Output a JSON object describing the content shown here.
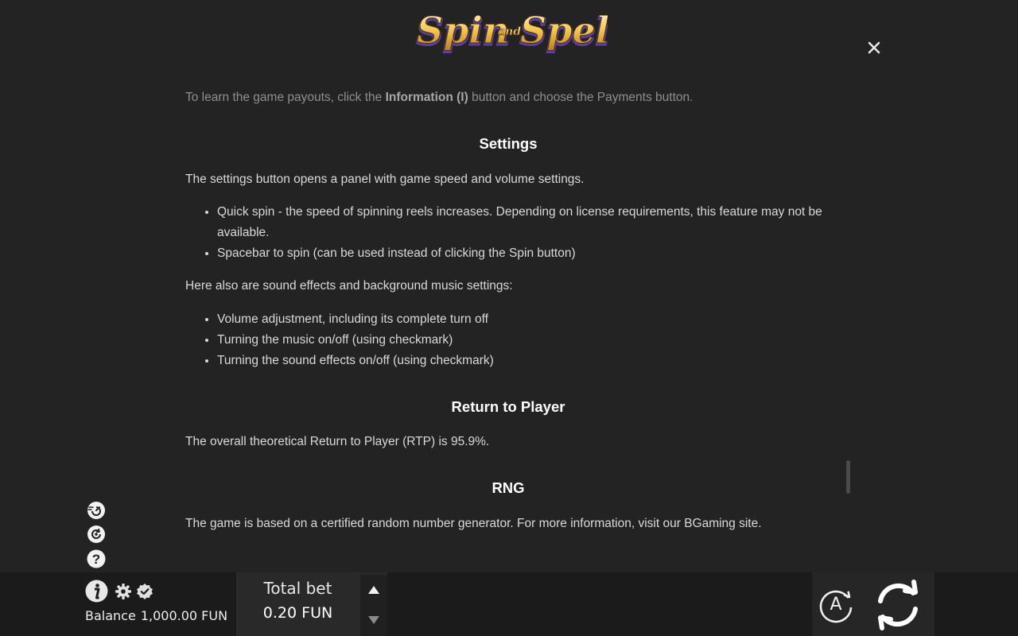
{
  "logo": {
    "word1": "Spin",
    "word2": "and",
    "word3": "Spell"
  },
  "close_icon": "close-icon",
  "rules": {
    "payouts_note": {
      "before": "To learn the game payouts, click the ",
      "bold": "Information (I)",
      "after": " button and choose the Payments button."
    },
    "settings": {
      "heading": "Settings",
      "intro": "The settings button opens a panel with game speed and volume settings.",
      "items": [
        "Quick spin - the speed of spinning reels increases. Depending on license requirements, this feature may not be available.",
        "Spacebar to spin (can be used instead of clicking the Spin button)"
      ],
      "sound_intro": "Here also are sound effects and background music settings:",
      "sound_items": [
        "Volume adjustment, including its complete turn off",
        "Turning the music on/off (using checkmark)",
        "Turning the sound effects on/off (using checkmark)"
      ]
    },
    "rtp": {
      "heading": "Return to Player",
      "text": "The overall theoretical Return to Player (RTP) is 95.9%."
    },
    "rng": {
      "heading": "RNG",
      "text": "The game is based on a certified random number generator. For more information, visit our BGaming site."
    }
  },
  "side_icons": [
    "quick-spin-icon",
    "replay-icon",
    "help-icon"
  ],
  "footer": {
    "info_icon": "info-icon",
    "settings_icon": "gear-icon",
    "verified_icon": "verified-badge-icon",
    "balance_label": "Balance",
    "balance_value": "1,000.00 FUN",
    "total_bet_label": "Total bet",
    "total_bet_value": "0.20 FUN",
    "autoplay_label": "A",
    "spin_icon": "spin-icon"
  },
  "colors": {
    "background": "#232323",
    "bar": "#1b1b1b",
    "heading": "#ffffff",
    "text": "#d9d9d9"
  }
}
